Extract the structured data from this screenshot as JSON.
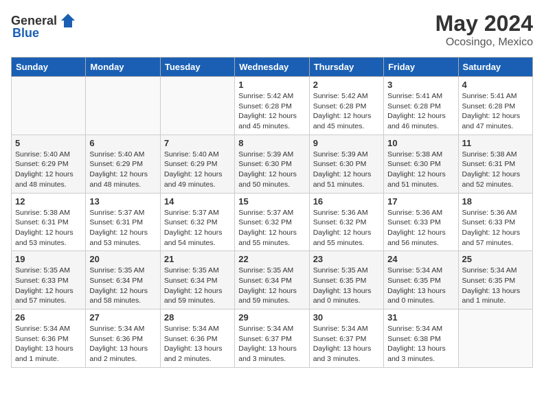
{
  "header": {
    "logo_general": "General",
    "logo_blue": "Blue",
    "title": "May 2024",
    "location": "Ocosingo, Mexico"
  },
  "weekdays": [
    "Sunday",
    "Monday",
    "Tuesday",
    "Wednesday",
    "Thursday",
    "Friday",
    "Saturday"
  ],
  "weeks": [
    [
      {
        "day": "",
        "info": ""
      },
      {
        "day": "",
        "info": ""
      },
      {
        "day": "",
        "info": ""
      },
      {
        "day": "1",
        "info": "Sunrise: 5:42 AM\nSunset: 6:28 PM\nDaylight: 12 hours\nand 45 minutes."
      },
      {
        "day": "2",
        "info": "Sunrise: 5:42 AM\nSunset: 6:28 PM\nDaylight: 12 hours\nand 45 minutes."
      },
      {
        "day": "3",
        "info": "Sunrise: 5:41 AM\nSunset: 6:28 PM\nDaylight: 12 hours\nand 46 minutes."
      },
      {
        "day": "4",
        "info": "Sunrise: 5:41 AM\nSunset: 6:28 PM\nDaylight: 12 hours\nand 47 minutes."
      }
    ],
    [
      {
        "day": "5",
        "info": "Sunrise: 5:40 AM\nSunset: 6:29 PM\nDaylight: 12 hours\nand 48 minutes."
      },
      {
        "day": "6",
        "info": "Sunrise: 5:40 AM\nSunset: 6:29 PM\nDaylight: 12 hours\nand 48 minutes."
      },
      {
        "day": "7",
        "info": "Sunrise: 5:40 AM\nSunset: 6:29 PM\nDaylight: 12 hours\nand 49 minutes."
      },
      {
        "day": "8",
        "info": "Sunrise: 5:39 AM\nSunset: 6:30 PM\nDaylight: 12 hours\nand 50 minutes."
      },
      {
        "day": "9",
        "info": "Sunrise: 5:39 AM\nSunset: 6:30 PM\nDaylight: 12 hours\nand 51 minutes."
      },
      {
        "day": "10",
        "info": "Sunrise: 5:38 AM\nSunset: 6:30 PM\nDaylight: 12 hours\nand 51 minutes."
      },
      {
        "day": "11",
        "info": "Sunrise: 5:38 AM\nSunset: 6:31 PM\nDaylight: 12 hours\nand 52 minutes."
      }
    ],
    [
      {
        "day": "12",
        "info": "Sunrise: 5:38 AM\nSunset: 6:31 PM\nDaylight: 12 hours\nand 53 minutes."
      },
      {
        "day": "13",
        "info": "Sunrise: 5:37 AM\nSunset: 6:31 PM\nDaylight: 12 hours\nand 53 minutes."
      },
      {
        "day": "14",
        "info": "Sunrise: 5:37 AM\nSunset: 6:32 PM\nDaylight: 12 hours\nand 54 minutes."
      },
      {
        "day": "15",
        "info": "Sunrise: 5:37 AM\nSunset: 6:32 PM\nDaylight: 12 hours\nand 55 minutes."
      },
      {
        "day": "16",
        "info": "Sunrise: 5:36 AM\nSunset: 6:32 PM\nDaylight: 12 hours\nand 55 minutes."
      },
      {
        "day": "17",
        "info": "Sunrise: 5:36 AM\nSunset: 6:33 PM\nDaylight: 12 hours\nand 56 minutes."
      },
      {
        "day": "18",
        "info": "Sunrise: 5:36 AM\nSunset: 6:33 PM\nDaylight: 12 hours\nand 57 minutes."
      }
    ],
    [
      {
        "day": "19",
        "info": "Sunrise: 5:35 AM\nSunset: 6:33 PM\nDaylight: 12 hours\nand 57 minutes."
      },
      {
        "day": "20",
        "info": "Sunrise: 5:35 AM\nSunset: 6:34 PM\nDaylight: 12 hours\nand 58 minutes."
      },
      {
        "day": "21",
        "info": "Sunrise: 5:35 AM\nSunset: 6:34 PM\nDaylight: 12 hours\nand 59 minutes."
      },
      {
        "day": "22",
        "info": "Sunrise: 5:35 AM\nSunset: 6:34 PM\nDaylight: 12 hours\nand 59 minutes."
      },
      {
        "day": "23",
        "info": "Sunrise: 5:35 AM\nSunset: 6:35 PM\nDaylight: 13 hours\nand 0 minutes."
      },
      {
        "day": "24",
        "info": "Sunrise: 5:34 AM\nSunset: 6:35 PM\nDaylight: 13 hours\nand 0 minutes."
      },
      {
        "day": "25",
        "info": "Sunrise: 5:34 AM\nSunset: 6:35 PM\nDaylight: 13 hours\nand 1 minute."
      }
    ],
    [
      {
        "day": "26",
        "info": "Sunrise: 5:34 AM\nSunset: 6:36 PM\nDaylight: 13 hours\nand 1 minute."
      },
      {
        "day": "27",
        "info": "Sunrise: 5:34 AM\nSunset: 6:36 PM\nDaylight: 13 hours\nand 2 minutes."
      },
      {
        "day": "28",
        "info": "Sunrise: 5:34 AM\nSunset: 6:36 PM\nDaylight: 13 hours\nand 2 minutes."
      },
      {
        "day": "29",
        "info": "Sunrise: 5:34 AM\nSunset: 6:37 PM\nDaylight: 13 hours\nand 3 minutes."
      },
      {
        "day": "30",
        "info": "Sunrise: 5:34 AM\nSunset: 6:37 PM\nDaylight: 13 hours\nand 3 minutes."
      },
      {
        "day": "31",
        "info": "Sunrise: 5:34 AM\nSunset: 6:38 PM\nDaylight: 13 hours\nand 3 minutes."
      },
      {
        "day": "",
        "info": ""
      }
    ]
  ]
}
